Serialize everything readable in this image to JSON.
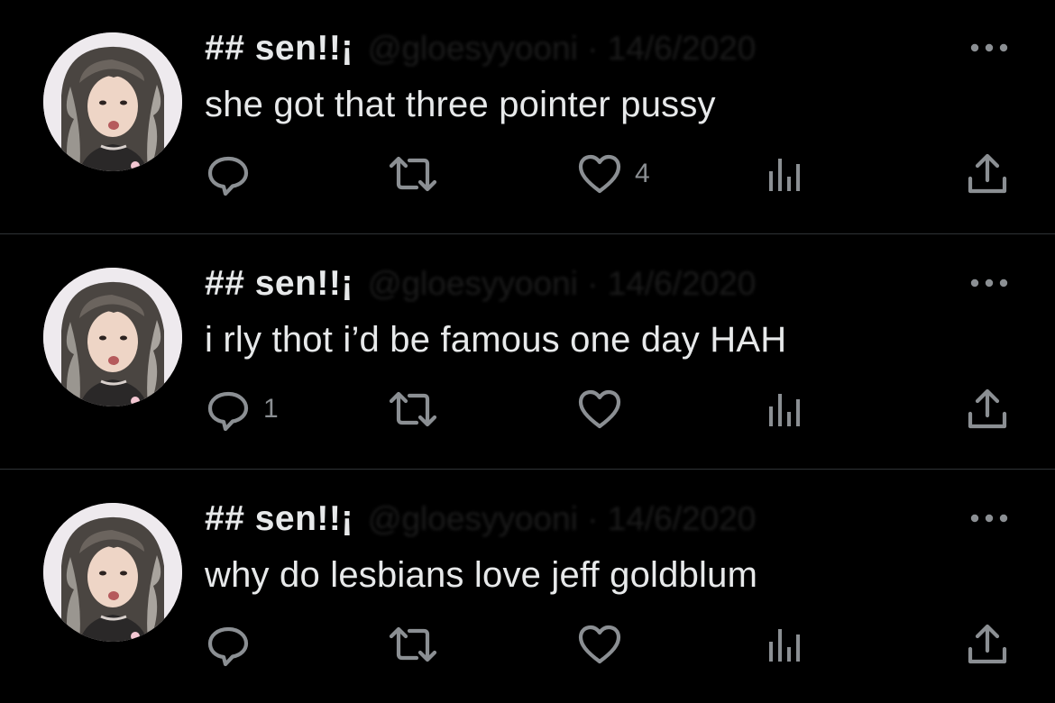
{
  "tweets": [
    {
      "display_name": "## sen!!¡",
      "handle_date": "@gloesyyooni · 14/6/2020",
      "text": "she got that three pointer pussy",
      "reply_count": "",
      "retweet_count": "",
      "like_count": "4"
    },
    {
      "display_name": "## sen!!¡",
      "handle_date": "@gloesyyooni · 14/6/2020",
      "text": "i rly thot i’d be famous one day HAH",
      "reply_count": "1",
      "retweet_count": "",
      "like_count": ""
    },
    {
      "display_name": "## sen!!¡",
      "handle_date": "@gloesyyooni · 14/6/2020",
      "text": "why do lesbians love jeff goldblum",
      "reply_count": "",
      "retweet_count": "",
      "like_count": ""
    }
  ],
  "icons": {
    "reply": "reply-icon",
    "retweet": "retweet-icon",
    "like": "heart-icon",
    "views": "views-icon",
    "share": "share-icon",
    "more": "more-icon"
  },
  "colors": {
    "background": "#000000",
    "text": "#e7e9ea",
    "icon": "#8b8f93",
    "divider": "#2f3336"
  }
}
